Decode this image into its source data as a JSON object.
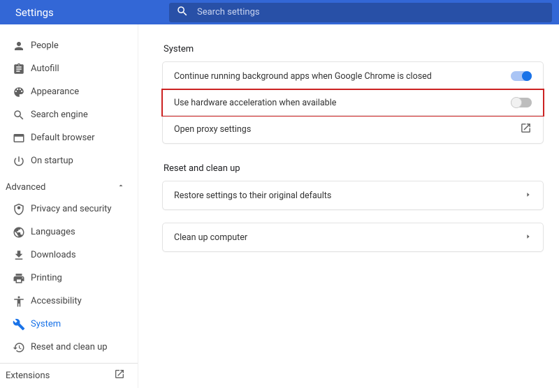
{
  "header": {
    "title": "Settings",
    "search_placeholder": "Search settings"
  },
  "sidebar": {
    "items": [
      {
        "label": "People"
      },
      {
        "label": "Autofill"
      },
      {
        "label": "Appearance"
      },
      {
        "label": "Search engine"
      },
      {
        "label": "Default browser"
      },
      {
        "label": "On startup"
      }
    ],
    "advanced_label": "Advanced",
    "advanced_items": [
      {
        "label": "Privacy and security"
      },
      {
        "label": "Languages"
      },
      {
        "label": "Downloads"
      },
      {
        "label": "Printing"
      },
      {
        "label": "Accessibility"
      },
      {
        "label": "System"
      },
      {
        "label": "Reset and clean up"
      }
    ],
    "extensions_label": "Extensions"
  },
  "main": {
    "system": {
      "title": "System",
      "rows": [
        {
          "label": "Continue running background apps when Google Chrome is closed"
        },
        {
          "label": "Use hardware acceleration when available"
        },
        {
          "label": "Open proxy settings"
        }
      ]
    },
    "reset": {
      "title": "Reset and clean up",
      "rows": [
        {
          "label": "Restore settings to their original defaults"
        },
        {
          "label": "Clean up computer"
        }
      ]
    }
  }
}
